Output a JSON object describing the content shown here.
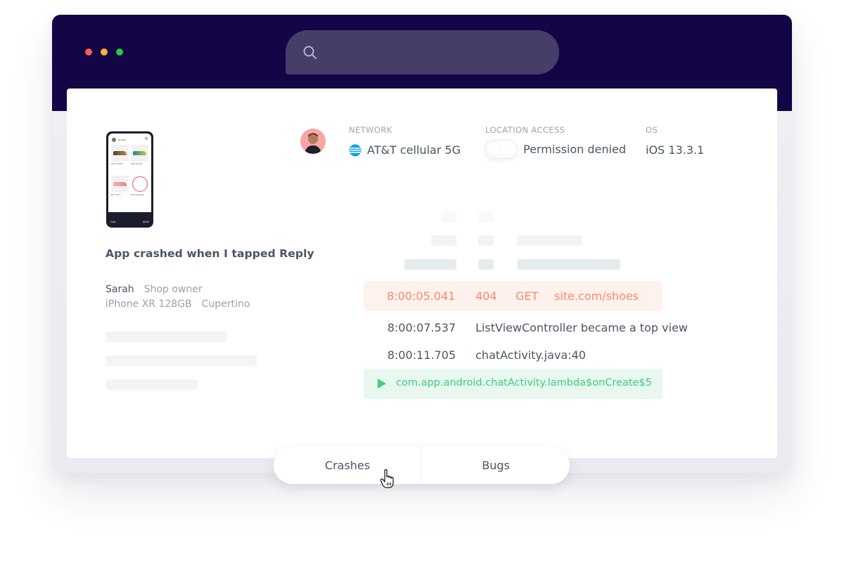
{
  "window": {
    "traffic_lights": [
      "close",
      "minimize",
      "maximize"
    ],
    "search": {
      "icon": "search-icon",
      "value": "",
      "placeholder": ""
    }
  },
  "phone_preview": {
    "header_title": "Browse",
    "products": [
      {
        "name": "Zoom Flyknit",
        "price": "$149"
      },
      {
        "name": "Nike Gravity",
        "price": "$219"
      },
      {
        "name": "Epic React",
        "price": "$169"
      },
      {
        "name": "Zoom Pegasus",
        "price": "$169"
      }
    ],
    "footer_left": "Cart",
    "footer_right": "$449"
  },
  "issue": {
    "title": "App crashed when I tapped Reply",
    "reporter_name": "Sarah",
    "reporter_role": "Shop owner",
    "device": "iPhone XR 128GB",
    "location": "Cupertino"
  },
  "device_info": {
    "network": {
      "label": "NETWORK",
      "value": "AT&T cellular 5G",
      "icon": "att-globe-icon"
    },
    "location": {
      "label": "LOCATION ACCESS",
      "value": "Permission denied",
      "toggle_on": false
    },
    "os": {
      "label": "OS",
      "value": "iOS 13.3.1"
    }
  },
  "log": {
    "error_row": {
      "time": "8:00:05.041",
      "status": "404",
      "method": "GET",
      "url": "site.com/shoes"
    },
    "rows": [
      {
        "time": "8:00:07.537",
        "message": "ListViewController became a top view"
      },
      {
        "time": "8:00:11.705",
        "message": "chatActivity.java:40"
      }
    ],
    "trace": "com.app.android.chatActivity.lambda$onCreate$5"
  },
  "tabs": [
    {
      "label": "Crashes",
      "active": true
    },
    {
      "label": "Bugs",
      "active": false
    }
  ],
  "colors": {
    "titlebar": "#140646",
    "error_text": "#f48c68",
    "error_bg": "#fff1ed",
    "success_text": "#3dcc7e",
    "success_bg": "#e8f8ef"
  }
}
